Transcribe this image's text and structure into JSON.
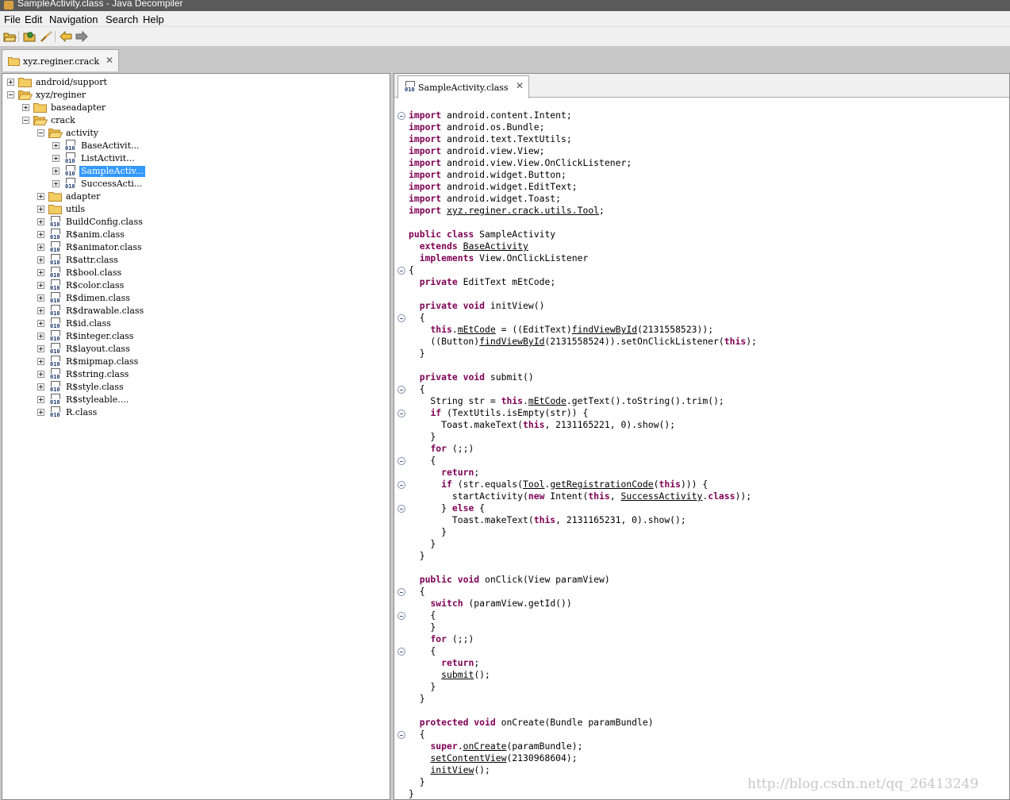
{
  "window": {
    "title": "SampleActivity.class - Java Decompiler"
  },
  "menu": [
    "File",
    "Edit",
    "Navigation",
    "Search",
    "Help"
  ],
  "toolbar": {
    "buttons": [
      {
        "name": "open-file-icon"
      },
      {
        "name": "open-type-icon"
      },
      {
        "name": "search-icon"
      },
      {
        "name": "back-arrow-icon"
      },
      {
        "name": "forward-arrow-icon"
      }
    ]
  },
  "file_tab": {
    "label": "xyz.reginer.crack"
  },
  "tree": [
    {
      "label": "android/support",
      "type": "folder",
      "level": 0,
      "expanded": false
    },
    {
      "label": "xyz/reginer",
      "type": "folder-open",
      "level": 0,
      "expanded": true
    },
    {
      "label": "baseadapter",
      "type": "folder",
      "level": 1,
      "expanded": false
    },
    {
      "label": "crack",
      "type": "folder-open",
      "level": 1,
      "expanded": true
    },
    {
      "label": "activity",
      "type": "folder-open",
      "level": 2,
      "expanded": true
    },
    {
      "label": "BaseActivit...",
      "type": "class",
      "level": 3,
      "expanded": false
    },
    {
      "label": "ListActivit...",
      "type": "class",
      "level": 3,
      "expanded": false
    },
    {
      "label": "SampleActiv...",
      "type": "class",
      "level": 3,
      "expanded": false,
      "selected": true
    },
    {
      "label": "SuccessActi...",
      "type": "class",
      "level": 3,
      "expanded": false
    },
    {
      "label": "adapter",
      "type": "folder",
      "level": 2,
      "expanded": false
    },
    {
      "label": "utils",
      "type": "folder",
      "level": 2,
      "expanded": false
    },
    {
      "label": "BuildConfig.class",
      "type": "class",
      "level": 2,
      "expanded": false
    },
    {
      "label": "R$anim.class",
      "type": "class",
      "level": 2,
      "expanded": false
    },
    {
      "label": "R$animator.class",
      "type": "class",
      "level": 2,
      "expanded": false
    },
    {
      "label": "R$attr.class",
      "type": "class",
      "level": 2,
      "expanded": false
    },
    {
      "label": "R$bool.class",
      "type": "class",
      "level": 2,
      "expanded": false
    },
    {
      "label": "R$color.class",
      "type": "class",
      "level": 2,
      "expanded": false
    },
    {
      "label": "R$dimen.class",
      "type": "class",
      "level": 2,
      "expanded": false
    },
    {
      "label": "R$drawable.class",
      "type": "class",
      "level": 2,
      "expanded": false
    },
    {
      "label": "R$id.class",
      "type": "class",
      "level": 2,
      "expanded": false
    },
    {
      "label": "R$integer.class",
      "type": "class",
      "level": 2,
      "expanded": false
    },
    {
      "label": "R$layout.class",
      "type": "class",
      "level": 2,
      "expanded": false
    },
    {
      "label": "R$mipmap.class",
      "type": "class",
      "level": 2,
      "expanded": false
    },
    {
      "label": "R$string.class",
      "type": "class",
      "level": 2,
      "expanded": false
    },
    {
      "label": "R$style.class",
      "type": "class",
      "level": 2,
      "expanded": false
    },
    {
      "label": "R$styleable....",
      "type": "class",
      "level": 2,
      "expanded": false
    },
    {
      "label": "R.class",
      "type": "class",
      "level": 2,
      "expanded": false
    }
  ],
  "editor_tab": {
    "label": "SampleActivity.class"
  },
  "code": [
    {
      "fold": true,
      "segs": [
        [
          "k",
          "import"
        ],
        [
          "t",
          " android.content.Intent;"
        ]
      ]
    },
    {
      "segs": [
        [
          "k",
          "import"
        ],
        [
          "t",
          " android.os.Bundle;"
        ]
      ]
    },
    {
      "segs": [
        [
          "k",
          "import"
        ],
        [
          "t",
          " android.text.TextUtils;"
        ]
      ]
    },
    {
      "segs": [
        [
          "k",
          "import"
        ],
        [
          "t",
          " android.view.View;"
        ]
      ]
    },
    {
      "segs": [
        [
          "k",
          "import"
        ],
        [
          "t",
          " android.view.View.OnClickListener;"
        ]
      ]
    },
    {
      "segs": [
        [
          "k",
          "import"
        ],
        [
          "t",
          " android.widget.Button;"
        ]
      ]
    },
    {
      "segs": [
        [
          "k",
          "import"
        ],
        [
          "t",
          " android.widget.EditText;"
        ]
      ]
    },
    {
      "segs": [
        [
          "k",
          "import"
        ],
        [
          "t",
          " android.widget.Toast;"
        ]
      ]
    },
    {
      "segs": [
        [
          "k",
          "import"
        ],
        [
          "t",
          " "
        ],
        [
          "u",
          "xyz.reginer.crack.utils.Tool"
        ],
        [
          "t",
          ";"
        ]
      ]
    },
    {
      "segs": []
    },
    {
      "segs": [
        [
          "k",
          "public class"
        ],
        [
          "t",
          " SampleActivity"
        ]
      ]
    },
    {
      "segs": [
        [
          "t",
          "  "
        ],
        [
          "k",
          "extends"
        ],
        [
          "t",
          " "
        ],
        [
          "u",
          "BaseActivity"
        ]
      ]
    },
    {
      "segs": [
        [
          "t",
          "  "
        ],
        [
          "k",
          "implements"
        ],
        [
          "t",
          " View.OnClickListener"
        ]
      ]
    },
    {
      "fold": true,
      "segs": [
        [
          "t",
          "{"
        ]
      ]
    },
    {
      "segs": [
        [
          "t",
          "  "
        ],
        [
          "k",
          "private"
        ],
        [
          "t",
          " EditText mEtCode;"
        ]
      ]
    },
    {
      "segs": []
    },
    {
      "segs": [
        [
          "t",
          "  "
        ],
        [
          "k",
          "private void"
        ],
        [
          "t",
          " initView()"
        ]
      ]
    },
    {
      "fold": true,
      "segs": [
        [
          "t",
          "  {"
        ]
      ]
    },
    {
      "segs": [
        [
          "t",
          "    "
        ],
        [
          "k",
          "this"
        ],
        [
          "t",
          "."
        ],
        [
          "u",
          "mEtCode"
        ],
        [
          "t",
          " = ((EditText)"
        ],
        [
          "u",
          "findViewById"
        ],
        [
          "t",
          "(2131558523));"
        ]
      ]
    },
    {
      "segs": [
        [
          "t",
          "    ((Button)"
        ],
        [
          "u",
          "findViewById"
        ],
        [
          "t",
          "(2131558524)).setOnClickListener("
        ],
        [
          "k",
          "this"
        ],
        [
          "t",
          ");"
        ]
      ]
    },
    {
      "segs": [
        [
          "t",
          "  }"
        ]
      ]
    },
    {
      "segs": []
    },
    {
      "segs": [
        [
          "t",
          "  "
        ],
        [
          "k",
          "private void"
        ],
        [
          "t",
          " submit()"
        ]
      ]
    },
    {
      "fold": true,
      "segs": [
        [
          "t",
          "  {"
        ]
      ]
    },
    {
      "segs": [
        [
          "t",
          "    String str = "
        ],
        [
          "k",
          "this"
        ],
        [
          "t",
          "."
        ],
        [
          "u",
          "mEtCode"
        ],
        [
          "t",
          ".getText().toString().trim();"
        ]
      ]
    },
    {
      "fold": true,
      "segs": [
        [
          "t",
          "    "
        ],
        [
          "k",
          "if"
        ],
        [
          "t",
          " (TextUtils.isEmpty(str)) {"
        ]
      ]
    },
    {
      "segs": [
        [
          "t",
          "      Toast.makeText("
        ],
        [
          "k",
          "this"
        ],
        [
          "t",
          ", 2131165221, 0).show();"
        ]
      ]
    },
    {
      "segs": [
        [
          "t",
          "    }"
        ]
      ]
    },
    {
      "segs": [
        [
          "t",
          "    "
        ],
        [
          "k",
          "for"
        ],
        [
          "t",
          " (;;)"
        ]
      ]
    },
    {
      "fold": true,
      "segs": [
        [
          "t",
          "    {"
        ]
      ]
    },
    {
      "segs": [
        [
          "t",
          "      "
        ],
        [
          "k",
          "return"
        ],
        [
          "t",
          ";"
        ]
      ]
    },
    {
      "fold": true,
      "segs": [
        [
          "t",
          "      "
        ],
        [
          "k",
          "if"
        ],
        [
          "t",
          " (str.equals("
        ],
        [
          "u",
          "Tool"
        ],
        [
          "t",
          "."
        ],
        [
          "u",
          "getRegistrationCode"
        ],
        [
          "t",
          "("
        ],
        [
          "k",
          "this"
        ],
        [
          "t",
          "))) {"
        ]
      ]
    },
    {
      "segs": [
        [
          "t",
          "        startActivity("
        ],
        [
          "k",
          "new"
        ],
        [
          "t",
          " Intent("
        ],
        [
          "k",
          "this"
        ],
        [
          "t",
          ", "
        ],
        [
          "u",
          "SuccessActivity"
        ],
        [
          "t",
          "."
        ],
        [
          "k",
          "class"
        ],
        [
          "t",
          "));"
        ]
      ]
    },
    {
      "fold": true,
      "segs": [
        [
          "t",
          "      } "
        ],
        [
          "k",
          "else"
        ],
        [
          "t",
          " {"
        ]
      ]
    },
    {
      "segs": [
        [
          "t",
          "        Toast.makeText("
        ],
        [
          "k",
          "this"
        ],
        [
          "t",
          ", 2131165231, 0).show();"
        ]
      ]
    },
    {
      "segs": [
        [
          "t",
          "      }"
        ]
      ]
    },
    {
      "segs": [
        [
          "t",
          "    }"
        ]
      ]
    },
    {
      "segs": [
        [
          "t",
          "  }"
        ]
      ]
    },
    {
      "segs": []
    },
    {
      "segs": [
        [
          "t",
          "  "
        ],
        [
          "k",
          "public void"
        ],
        [
          "t",
          " onClick(View paramView)"
        ]
      ]
    },
    {
      "fold": true,
      "segs": [
        [
          "t",
          "  {"
        ]
      ]
    },
    {
      "segs": [
        [
          "t",
          "    "
        ],
        [
          "k",
          "switch"
        ],
        [
          "t",
          " (paramView.getId())"
        ]
      ]
    },
    {
      "fold": true,
      "segs": [
        [
          "t",
          "    {"
        ]
      ]
    },
    {
      "segs": [
        [
          "t",
          "    }"
        ]
      ]
    },
    {
      "segs": [
        [
          "t",
          "    "
        ],
        [
          "k",
          "for"
        ],
        [
          "t",
          " (;;)"
        ]
      ]
    },
    {
      "fold": true,
      "segs": [
        [
          "t",
          "    {"
        ]
      ]
    },
    {
      "segs": [
        [
          "t",
          "      "
        ],
        [
          "k",
          "return"
        ],
        [
          "t",
          ";"
        ]
      ]
    },
    {
      "segs": [
        [
          "t",
          "      "
        ],
        [
          "u",
          "submit"
        ],
        [
          "t",
          "();"
        ]
      ]
    },
    {
      "segs": [
        [
          "t",
          "    }"
        ]
      ]
    },
    {
      "segs": [
        [
          "t",
          "  }"
        ]
      ]
    },
    {
      "segs": []
    },
    {
      "segs": [
        [
          "t",
          "  "
        ],
        [
          "k",
          "protected void"
        ],
        [
          "t",
          " onCreate(Bundle paramBundle)"
        ]
      ]
    },
    {
      "fold": true,
      "segs": [
        [
          "t",
          "  {"
        ]
      ]
    },
    {
      "segs": [
        [
          "t",
          "    "
        ],
        [
          "k",
          "super"
        ],
        [
          "t",
          "."
        ],
        [
          "u",
          "onCreate"
        ],
        [
          "t",
          "(paramBundle);"
        ]
      ]
    },
    {
      "segs": [
        [
          "t",
          "    "
        ],
        [
          "u",
          "setContentView"
        ],
        [
          "t",
          "(2130968604);"
        ]
      ]
    },
    {
      "segs": [
        [
          "t",
          "    "
        ],
        [
          "u",
          "initView"
        ],
        [
          "t",
          "();"
        ]
      ]
    },
    {
      "segs": [
        [
          "t",
          "  }"
        ]
      ]
    },
    {
      "segs": [
        [
          "t",
          "}"
        ]
      ]
    }
  ],
  "watermark": "http://blog.csdn.net/qq_26413249"
}
